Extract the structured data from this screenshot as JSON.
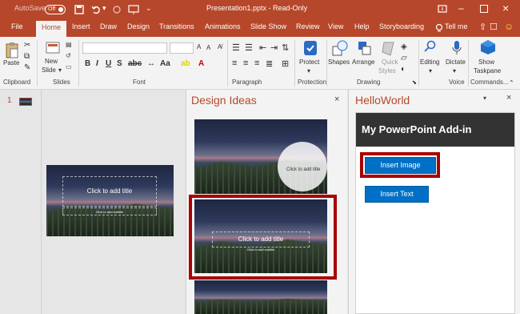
{
  "titlebar": {
    "autosave_label": "AutoSave",
    "autosave_state": "Off",
    "document_title": "Presentation1.pptx - Read-Only",
    "colors": {
      "brand": "#b7472a"
    }
  },
  "tabs": [
    {
      "label": "File"
    },
    {
      "label": "Home"
    },
    {
      "label": "Insert"
    },
    {
      "label": "Draw"
    },
    {
      "label": "Design"
    },
    {
      "label": "Transitions"
    },
    {
      "label": "Animations"
    },
    {
      "label": "Slide Show"
    },
    {
      "label": "Review"
    },
    {
      "label": "View"
    },
    {
      "label": "Help"
    },
    {
      "label": "Storyboarding"
    }
  ],
  "tell_me": "Tell me",
  "ribbon": {
    "groups": {
      "clipboard": "Clipboard",
      "slides": "Slides",
      "font": "Font",
      "paragraph": "Paragraph",
      "protection": "Protection",
      "drawing": "Drawing",
      "voice": "Voice",
      "commands": "Commands..."
    },
    "buttons": {
      "paste": "Paste",
      "new_slide_1": "New",
      "new_slide_2": "Slide",
      "protect": "Protect",
      "shapes": "Shapes",
      "arrange": "Arrange",
      "quick_1": "Quick",
      "quick_2": "Styles",
      "editing": "Editing",
      "dictate": "Dictate",
      "show_1": "Show",
      "show_2": "Taskpane"
    }
  },
  "thumbnail": {
    "number": "1"
  },
  "slide": {
    "title_placeholder": "Click to add title",
    "subtitle_placeholder": "Click to add subtitle"
  },
  "design_ideas": {
    "title": "Design Ideas",
    "idea1_title": "Click to add title",
    "idea2_title": "Click to add title",
    "idea2_subtitle": "Click to add subtitle"
  },
  "addin": {
    "pane_title": "HelloWorld",
    "header": "My PowerPoint Add-in",
    "insert_image": "Insert Image",
    "insert_text": "Insert Text",
    "accent": "#0070c6",
    "highlight": "#a80000"
  }
}
